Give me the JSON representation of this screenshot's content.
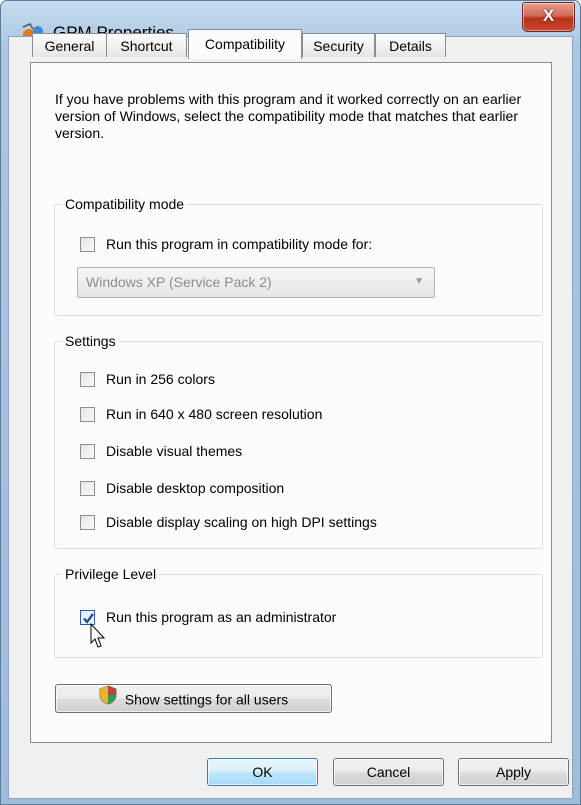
{
  "window": {
    "title": "GPM Properties",
    "close_label": "X",
    "colors": {
      "accent": "#3c7fb1",
      "close": "#c9452c",
      "frame": "#a9c6e2"
    }
  },
  "tabs": [
    {
      "label": "General",
      "active": false
    },
    {
      "label": "Shortcut",
      "active": false
    },
    {
      "label": "Compatibility",
      "active": true
    },
    {
      "label": "Security",
      "active": false
    },
    {
      "label": "Details",
      "active": false
    }
  ],
  "intro_text": "If you have problems with this program and it worked correctly on an earlier version of Windows, select the compatibility mode that matches that earlier version.",
  "compatibility_mode": {
    "label": "Compatibility mode",
    "checkbox": {
      "label": "Run this program in compatibility mode for:",
      "checked": false
    },
    "dropdown": {
      "value": "Windows XP (Service Pack 2)",
      "enabled": false
    }
  },
  "settings": {
    "label": "Settings",
    "items": [
      {
        "label": "Run in 256 colors",
        "checked": false
      },
      {
        "label": "Run in 640 x 480 screen resolution",
        "checked": false
      },
      {
        "label": "Disable visual themes",
        "checked": false
      },
      {
        "label": "Disable desktop composition",
        "checked": false
      },
      {
        "label": "Disable display scaling on high DPI settings",
        "checked": false
      }
    ]
  },
  "privilege_level": {
    "label": "Privilege Level",
    "checkbox": {
      "label": "Run this program as an administrator",
      "checked": true
    }
  },
  "show_settings_button": {
    "label": "Show settings for all users",
    "icon": "uac-shield-icon"
  },
  "footer_buttons": {
    "ok": "OK",
    "cancel": "Cancel",
    "apply": "Apply"
  }
}
